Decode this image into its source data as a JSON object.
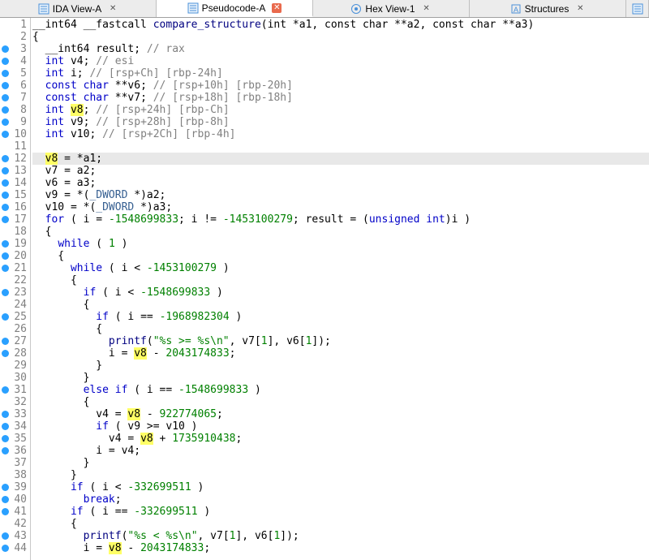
{
  "tabs": [
    {
      "label": "IDA View-A",
      "icon": "list-icon",
      "active": false,
      "closeRed": false
    },
    {
      "label": "Pseudocode-A",
      "icon": "list-icon",
      "active": true,
      "closeRed": true
    },
    {
      "label": "Hex View-1",
      "icon": "hex-icon",
      "active": false,
      "closeRed": false
    },
    {
      "label": "Structures",
      "icon": "struct-icon",
      "active": false,
      "closeRed": false
    }
  ],
  "more_tab_icon": "list-icon",
  "gutter": {
    "start": 1,
    "end": 44,
    "breakpoints": [
      3,
      4,
      5,
      6,
      7,
      8,
      9,
      10,
      12,
      13,
      14,
      15,
      16,
      17,
      19,
      20,
      21,
      23,
      25,
      27,
      28,
      31,
      33,
      34,
      35,
      36,
      39,
      40,
      41,
      43,
      44
    ]
  },
  "code": {
    "l1": {
      "pre": "__int64 __fastcall ",
      "fn": "compare_structure",
      "post": "(int *a1, const char **a2, const char **a3)"
    },
    "l2": "{",
    "l3": {
      "a": "  __int64 result; ",
      "c": "// rax"
    },
    "l4": {
      "a": "  ",
      "kw": "int",
      "b": " v4; ",
      "c": "// esi"
    },
    "l5": {
      "a": "  ",
      "kw": "int",
      "b": " i; ",
      "c": "// [rsp+Ch] [rbp-24h]"
    },
    "l6": {
      "a": "  ",
      "kw": "const char",
      "b": " **v6; ",
      "c": "// [rsp+10h] [rbp-20h]"
    },
    "l7": {
      "a": "  ",
      "kw": "const char",
      "b": " **v7; ",
      "c": "// [rsp+18h] [rbp-18h]"
    },
    "l8": {
      "a": "  ",
      "kw": "int",
      "b1": " ",
      "hl": "v8",
      "b2": "; ",
      "c": "// [rsp+24h] [rbp-Ch]"
    },
    "l9": {
      "a": "  ",
      "kw": "int",
      "b": " v9; ",
      "c": "// [rsp+28h] [rbp-8h]"
    },
    "l10": {
      "a": "  ",
      "kw": "int",
      "b": " v10; ",
      "c": "// [rsp+2Ch] [rbp-4h]"
    },
    "l11": "",
    "l12": {
      "a": "  ",
      "hl": "v8",
      "b": " = *a1;"
    },
    "l13": "  v7 = a2;",
    "l14": "  v6 = a3;",
    "l15": {
      "a": "  v9 = *(",
      "id": "_DWORD",
      "b": " *)a2;"
    },
    "l16": {
      "a": "  v10 = *(",
      "id": "_DWORD",
      "b": " *)a3;"
    },
    "l17": {
      "a": "  ",
      "kw": "for",
      "b": " ( i = ",
      "n1": "-1548699833",
      "c": "; i != ",
      "n2": "-1453100279",
      "d": "; result = (",
      "kw2": "unsigned int",
      "e": ")i )"
    },
    "l18": "  {",
    "l19": {
      "a": "    ",
      "kw": "while",
      "b": " ( ",
      "n": "1",
      "c": " )"
    },
    "l20": "    {",
    "l21": {
      "a": "      ",
      "kw": "while",
      "b": " ( i < ",
      "n": "-1453100279",
      "c": " )"
    },
    "l22": "      {",
    "l23": {
      "a": "        ",
      "kw": "if",
      "b": " ( i < ",
      "n": "-1548699833",
      "c": " )"
    },
    "l24": "        {",
    "l25": {
      "a": "          ",
      "kw": "if",
      "b": " ( i == ",
      "n": "-1968982304",
      "c": " )"
    },
    "l26": "          {",
    "l27": {
      "a": "            ",
      "fn": "printf",
      "b": "(",
      "s": "\"%s >= %s\\n\"",
      "c": ", v7[",
      "n1": "1",
      "d": "], v6[",
      "n2": "1",
      "e": "]);"
    },
    "l28": {
      "a": "            i = ",
      "hl": "v8",
      "b": " - ",
      "n": "2043174833",
      "c": ";"
    },
    "l29": "          }",
    "l30": "        }",
    "l31": {
      "a": "        ",
      "kw": "else if",
      "b": " ( i == ",
      "n": "-1548699833",
      "c": " )"
    },
    "l32": "        {",
    "l33": {
      "a": "          v4 = ",
      "hl": "v8",
      "b": " - ",
      "n": "922774065",
      "c": ";"
    },
    "l34": {
      "a": "          ",
      "kw": "if",
      "b": " ( v9 >= v10 )"
    },
    "l35": {
      "a": "            v4 = ",
      "hl": "v8",
      "b": " + ",
      "n": "1735910438",
      "c": ";"
    },
    "l36": "          i = v4;",
    "l37": "        }",
    "l38": "      }",
    "l39": {
      "a": "      ",
      "kw": "if",
      "b": " ( i < ",
      "n": "-332699511",
      "c": " )"
    },
    "l40": {
      "a": "        ",
      "kw": "break",
      "b": ";"
    },
    "l41": {
      "a": "      ",
      "kw": "if",
      "b": " ( i == ",
      "n": "-332699511",
      "c": " )"
    },
    "l42": "      {",
    "l43": {
      "a": "        ",
      "fn": "printf",
      "b": "(",
      "s": "\"%s < %s\\n\"",
      "c": ", v7[",
      "n1": "1",
      "d": "], v6[",
      "n2": "1",
      "e": "]);"
    },
    "l44": {
      "a": "        i = ",
      "hl": "v8",
      "b": " - ",
      "n": "2043174833",
      "c": ";"
    }
  }
}
